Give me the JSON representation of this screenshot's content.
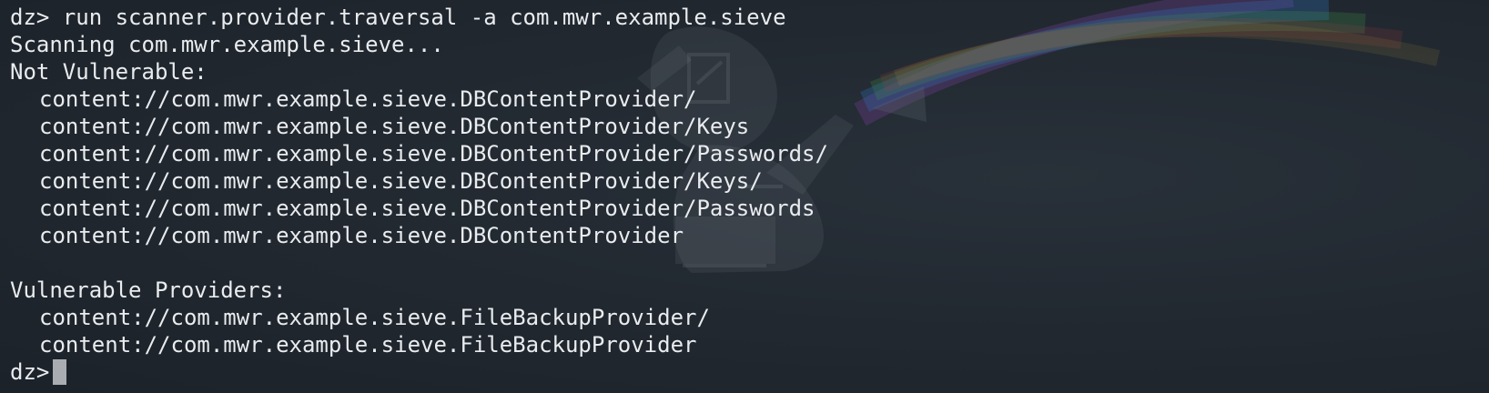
{
  "terminal": {
    "prompt": "dz>",
    "command": "run scanner.provider.traversal -a com.mwr.example.sieve",
    "scanning_line": "Scanning com.mwr.example.sieve...",
    "not_vulnerable_header": "Not Vulnerable:",
    "not_vulnerable": [
      "content://com.mwr.example.sieve.DBContentProvider/",
      "content://com.mwr.example.sieve.DBContentProvider/Keys",
      "content://com.mwr.example.sieve.DBContentProvider/Passwords/",
      "content://com.mwr.example.sieve.DBContentProvider/Keys/",
      "content://com.mwr.example.sieve.DBContentProvider/Passwords",
      "content://com.mwr.example.sieve.DBContentProvider"
    ],
    "vulnerable_header": "Vulnerable Providers:",
    "vulnerable": [
      "content://com.mwr.example.sieve.FileBackupProvider/",
      "content://com.mwr.example.sieve.FileBackupProvider"
    ]
  },
  "colors": {
    "background": "#1f252d",
    "text": "#e9ecef",
    "cursor": "#a9adb2"
  }
}
